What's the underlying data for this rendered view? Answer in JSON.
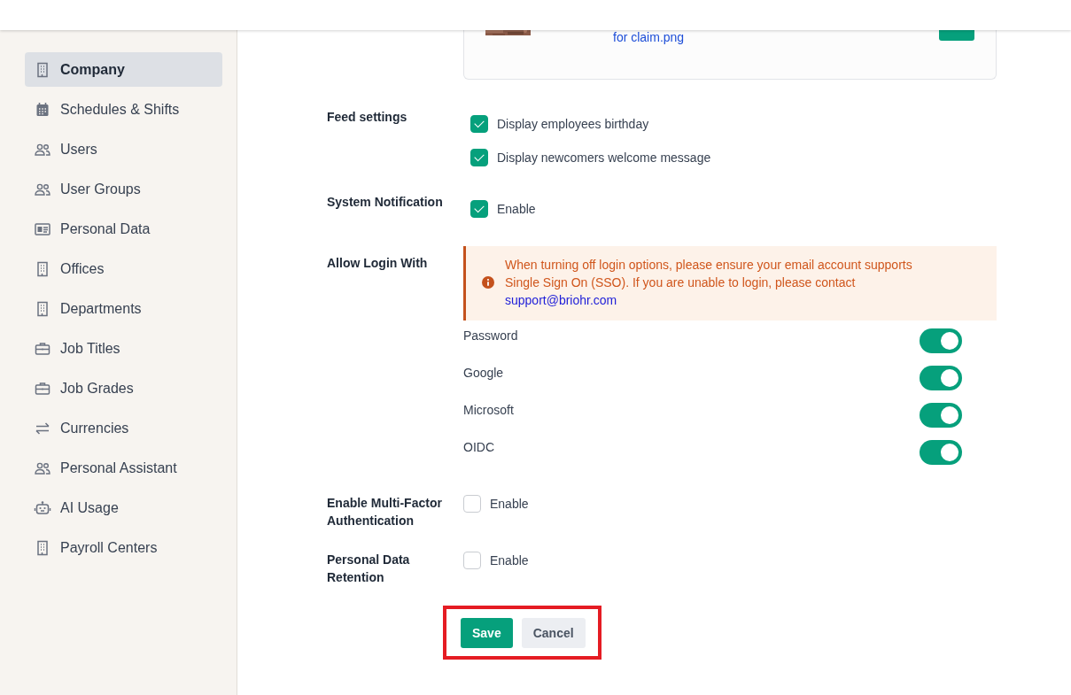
{
  "sidebar": {
    "items": [
      {
        "label": "Company",
        "kind": "building",
        "selected": true
      },
      {
        "label": "Schedules & Shifts",
        "kind": "calendar",
        "selected": false
      },
      {
        "label": "Users",
        "kind": "people",
        "selected": false
      },
      {
        "label": "User Groups",
        "kind": "people",
        "selected": false
      },
      {
        "label": "Personal Data",
        "kind": "idcard",
        "selected": false
      },
      {
        "label": "Offices",
        "kind": "building",
        "selected": false
      },
      {
        "label": "Departments",
        "kind": "building",
        "selected": false
      },
      {
        "label": "Job Titles",
        "kind": "briefcase",
        "selected": false
      },
      {
        "label": "Job Grades",
        "kind": "briefcase",
        "selected": false
      },
      {
        "label": "Currencies",
        "kind": "arrows",
        "selected": false
      },
      {
        "label": "Personal Assistant",
        "kind": "people",
        "selected": false
      },
      {
        "label": "AI Usage",
        "kind": "robot",
        "selected": false
      },
      {
        "label": "Payroll Centers",
        "kind": "building",
        "selected": false
      }
    ]
  },
  "attachment": {
    "file_link": "for claim.png"
  },
  "settings": [
    {
      "label": "Feed settings",
      "kind": "checks",
      "options": [
        {
          "label": "Display employees birthday",
          "checked": true
        },
        {
          "label": "Display newcomers welcome message",
          "checked": true
        }
      ]
    },
    {
      "label": "System Notification",
      "kind": "checks",
      "options": [
        {
          "label": "Enable",
          "checked": true
        }
      ]
    },
    {
      "label": "Allow Login With",
      "kind": "login",
      "alert": {
        "text": "When turning off login options, please ensure your email account supports Single Sign On (SSO). If you are unable to login, please contact",
        "link": "support@briohr.com"
      },
      "options": [
        {
          "label": "Password",
          "on": true
        },
        {
          "label": "Google",
          "on": true
        },
        {
          "label": "Microsoft",
          "on": true
        },
        {
          "label": "OIDC",
          "on": true
        }
      ]
    },
    {
      "label": "Enable Multi-Factor Authentication",
      "kind": "checks",
      "options": [
        {
          "label": "Enable",
          "checked": false
        }
      ]
    },
    {
      "label": "Personal Data Retention",
      "kind": "checks",
      "options": [
        {
          "label": "Enable",
          "checked": false
        }
      ]
    }
  ],
  "actions": {
    "highlighted": true,
    "buttons": [
      {
        "label": "Save",
        "kind": "primary"
      },
      {
        "label": "Cancel",
        "kind": "secondary"
      }
    ]
  }
}
